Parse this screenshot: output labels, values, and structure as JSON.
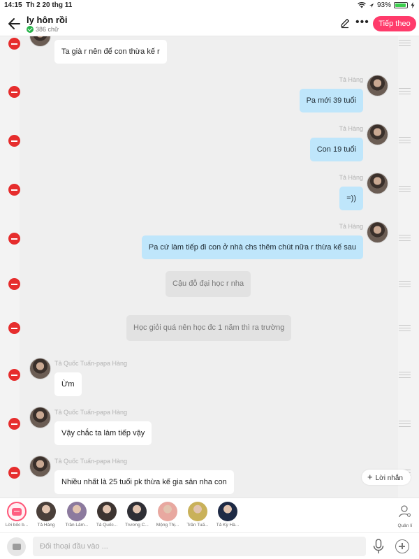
{
  "status": {
    "time": "14:15",
    "date": "Th 2 20 thg 11",
    "battery": "93%",
    "battery_level": 0.93
  },
  "header": {
    "title": "ly hôn rồi",
    "word_count": "386 chữ",
    "next_label": "Tiếp theo"
  },
  "messages": [
    {
      "side": "left",
      "sender": "",
      "text": "Ta già r nên để con thừa kế r"
    },
    {
      "side": "right",
      "sender": "Tả Hàng",
      "text": "Pa mới 39 tuổi"
    },
    {
      "side": "right",
      "sender": "Tả Hàng",
      "text": "Con 19 tuổi"
    },
    {
      "side": "right",
      "sender": "Tả Hàng",
      "text": "=))"
    },
    {
      "side": "right",
      "sender": "Tả Hàng",
      "text": "Pa cứ làm tiếp đi con ở nhà chs thêm chút nữa r thừa kế sau"
    },
    {
      "side": "center",
      "sender": "",
      "text": "Cậu đỗ đại học r nha"
    },
    {
      "side": "center",
      "sender": "",
      "text": "Học giỏi quá nên học đc 1 năm thì ra trường"
    },
    {
      "side": "left",
      "sender": "Tả Quốc Tuấn-papa Hàng",
      "text": "Ừm"
    },
    {
      "side": "left",
      "sender": "Tả Quốc Tuấn-papa Hàng",
      "text": "Vậy chắc ta làm tiếp vậy"
    },
    {
      "side": "left",
      "sender": "Tả Quốc Tuấn-papa Hàng",
      "text": "Nhiều nhất là 25 tuổi pk thừa kế gia sản nha con"
    }
  ],
  "reply_button": "Lời nhắn",
  "characters": [
    {
      "label": "Lời bốc b...",
      "color": "#ff5d80"
    },
    {
      "label": "Tả Hàng",
      "color": "#4a3f3a"
    },
    {
      "label": "Trần Lâm...",
      "color": "#8c7a9e"
    },
    {
      "label": "Tả Quốc...",
      "color": "#3d3431"
    },
    {
      "label": "Trương C...",
      "color": "#2f2f35"
    },
    {
      "label": "Mộng Thị...",
      "color": "#e8a8a0"
    },
    {
      "label": "Trần Tuấ...",
      "color": "#c9b15a"
    },
    {
      "label": "Tả Kỳ Hà...",
      "color": "#1e2a45"
    }
  ],
  "manage_label": "Quản lí",
  "input": {
    "placeholder": "Đối thoại đầu vào ..."
  }
}
